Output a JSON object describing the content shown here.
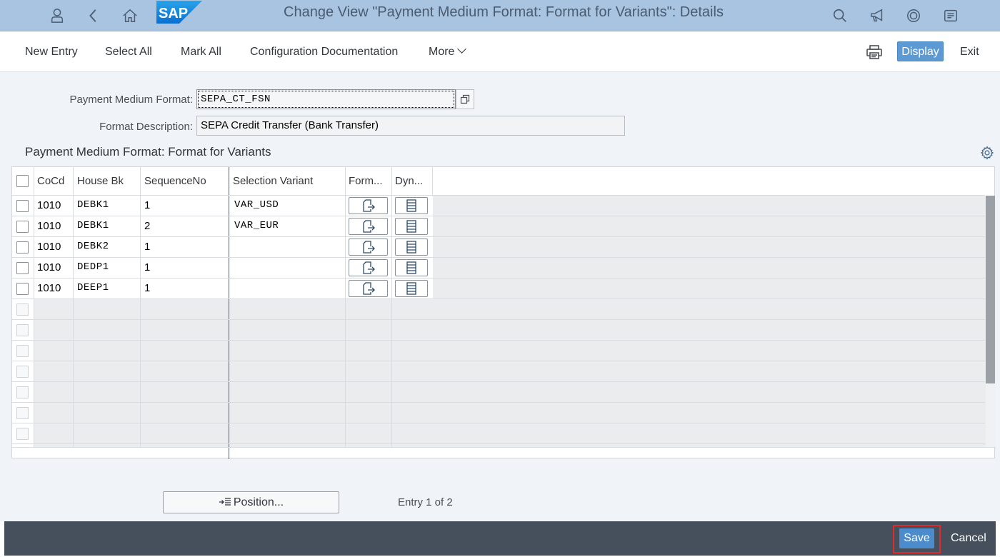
{
  "shell": {
    "title": "Change View \"Payment Medium Format: Format for Variants\": Details",
    "logo_text": "SAP",
    "left_icons": [
      "user-icon",
      "back-icon",
      "home-icon"
    ],
    "right_icons": [
      "search-icon",
      "notifications-icon",
      "help-icon",
      "menu-icon"
    ],
    "bg_color": "#a8c4e0"
  },
  "toolbar": {
    "new_entry": "New Entry",
    "select_all": "Select All",
    "mark_all": "Mark All",
    "config_doc": "Configuration Documentation",
    "more": "More",
    "display": "Display",
    "exit": "Exit",
    "accent_color": "#5d9ad4"
  },
  "header_fields": {
    "pmf_label": "Payment Medium Format:",
    "pmf_value": "SEPA_CT_FSN",
    "desc_label": "Format Description:",
    "desc_value": "SEPA Credit Transfer (Bank Transfer)"
  },
  "section": {
    "title": "Payment Medium Format: Format for Variants"
  },
  "table": {
    "columns": [
      "CoCd",
      "House Bk",
      "SequenceNo",
      "Selection Variant",
      "Form...",
      "Dyn..."
    ],
    "rows": [
      {
        "cocd": "1010",
        "house_bk": "DEBK1",
        "seq": "1",
        "variant": "VAR_USD"
      },
      {
        "cocd": "1010",
        "house_bk": "DEBK1",
        "seq": "2",
        "variant": "VAR_EUR"
      },
      {
        "cocd": "1010",
        "house_bk": "DEBK2",
        "seq": "1",
        "variant": ""
      },
      {
        "cocd": "1010",
        "house_bk": "DEDP1",
        "seq": "1",
        "variant": ""
      },
      {
        "cocd": "1010",
        "house_bk": "DEEP1",
        "seq": "1",
        "variant": ""
      }
    ],
    "empty_rows": 7
  },
  "footer_area": {
    "position_button": "Position...",
    "entry_info": "Entry 1 of 2"
  },
  "footer": {
    "save": "Save",
    "cancel": "Cancel",
    "bg_color": "#46505c",
    "highlight_color": "#e02b2b"
  }
}
